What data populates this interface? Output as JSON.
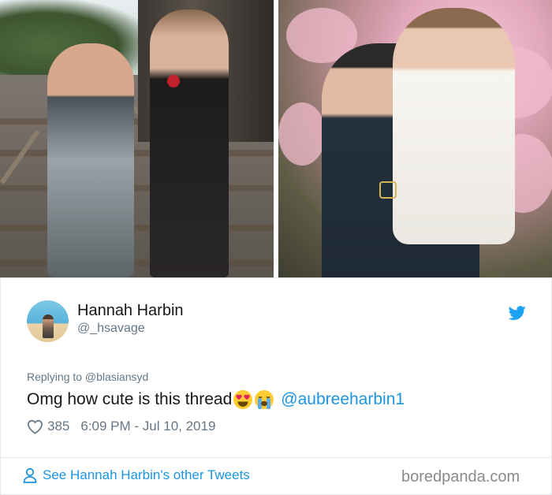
{
  "tweet": {
    "display_name": "Hannah Harbin",
    "handle": "@_hsavage",
    "replying_to": "Replying to @blasiansyd",
    "text": "Omg how cute is this thread",
    "emojis": [
      "heart-eyes-face",
      "loudly-crying-face"
    ],
    "mention": "@aubreeharbin1",
    "like_count": "385",
    "timestamp": "6:09 PM - Jul 10, 2019",
    "footer_link": "See Hannah Harbin's other Tweets"
  },
  "branding": {
    "twitter_icon": "twitter-bird-icon",
    "watermark": "boredpanda.com"
  },
  "colors": {
    "twitter_blue": "#1da1f2",
    "link_blue": "#1b95e0",
    "secondary_text": "#657786",
    "primary_text": "#14171a",
    "border": "#e1e8ed"
  }
}
